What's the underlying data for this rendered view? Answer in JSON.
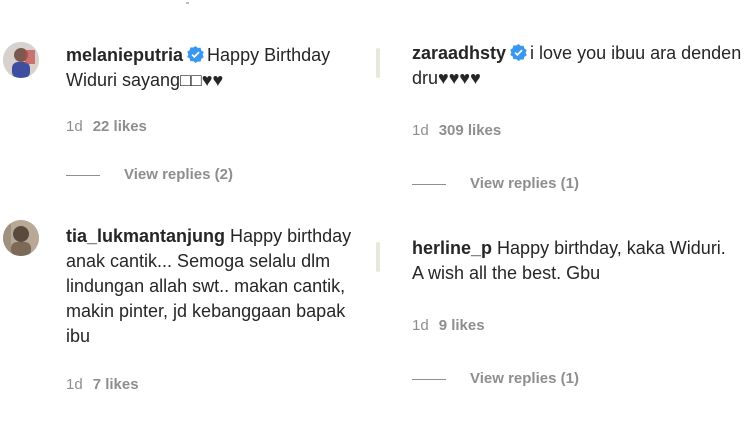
{
  "comments": [
    {
      "username": "melanieputria",
      "verified": true,
      "text": "Happy Birthday Widuri sayang□□♥♥",
      "time": "1d",
      "likes": "22 likes",
      "replies": "View replies (2)"
    },
    {
      "username": "zaraadhsty",
      "verified": true,
      "text": "i love you ibuu ara denden dru♥♥♥♥",
      "time": "1d",
      "likes": "309 likes",
      "replies": "View replies (1)"
    },
    {
      "username": "tia_lukmantanjung",
      "verified": false,
      "text": "Happy birthday anak cantik... Semoga selalu dlm lindungan allah swt.. makan cantik, makin pinter, jd kebanggaan bapak ibu",
      "time": "1d",
      "likes": "7 likes"
    },
    {
      "username": "herline_p",
      "verified": false,
      "text": "Happy birthday, kaka Widuri. A wish all the best. Gbu",
      "time": "1d",
      "likes": "9 likes",
      "replies": "View replies (1)"
    }
  ],
  "colors": {
    "text": "#262626",
    "muted": "#8e8e8e",
    "verified": "#3897f0"
  }
}
